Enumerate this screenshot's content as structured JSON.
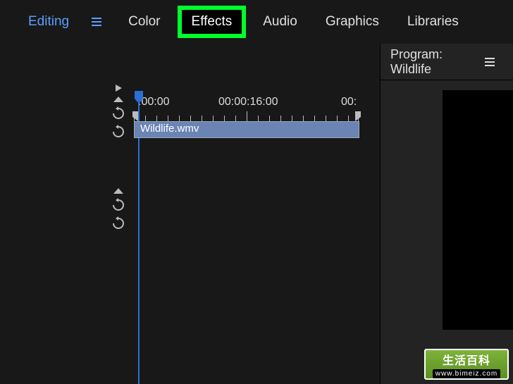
{
  "topbar": {
    "tabs": {
      "editing": "Editing",
      "color": "Color",
      "effects": "Effects",
      "audio": "Audio",
      "graphics": "Graphics",
      "libraries": "Libraries"
    }
  },
  "program_panel": {
    "title": "Program: Wildlife"
  },
  "timeline": {
    "ruler": {
      "t0": ":00:00",
      "t1": "00:00:16:00",
      "t2": "00:"
    },
    "clip_name": "Wildlife.wmv"
  },
  "watermark": {
    "line1": "生活百科",
    "line2": "www.bimeiz.com"
  }
}
